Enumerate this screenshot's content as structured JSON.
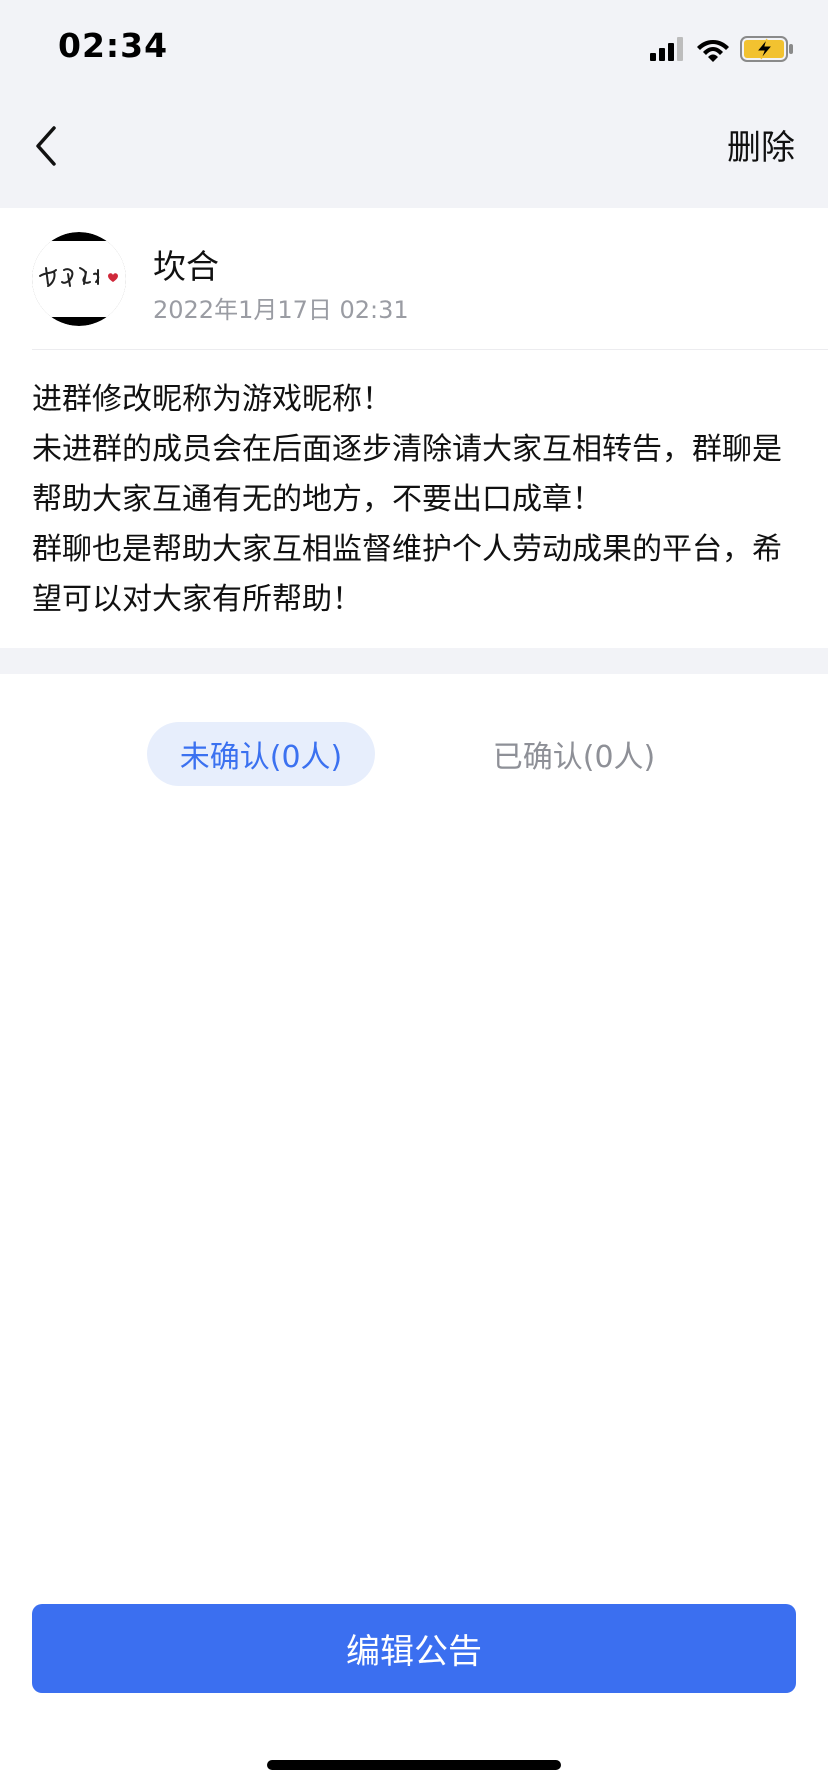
{
  "status_bar": {
    "time": "02:34",
    "icons": [
      "cellular-signal-icon",
      "wifi-icon",
      "battery-charging-icon"
    ]
  },
  "nav": {
    "back_icon": "chevron-left-icon",
    "delete_label": "删除"
  },
  "author": {
    "name": "坎合",
    "timestamp": "2022年1月17日 02:31",
    "avatar_text": "我爱你"
  },
  "announcement": {
    "lines": [
      "进群修改昵称为游戏昵称！",
      "未进群的成员会在后面逐步清除请大家互相转告，群聊是帮助大家互通有无的地方，不要出口成章！",
      "群聊也是帮助大家互相监督维护个人劳动成果的平台，希望可以对大家有所帮助！"
    ]
  },
  "tabs": {
    "unconfirmed_label": "未确认(0人)",
    "confirmed_label": "已确认(0人)"
  },
  "footer": {
    "edit_label": "编辑公告"
  },
  "colors": {
    "accent": "#3b6ff0",
    "tab_active_bg": "#e7eefc",
    "header_bg": "#f2f3f7",
    "muted_text": "#9a9ca3"
  }
}
